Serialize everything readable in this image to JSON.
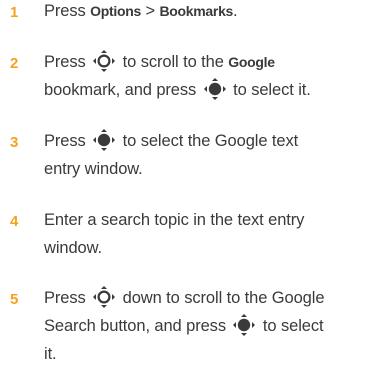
{
  "colors": {
    "accent": "#f4a21f",
    "text": "#3a3a3a"
  },
  "icons": {
    "nav_scroll": "nav-scroll-key-icon",
    "nav_select": "nav-select-key-icon"
  },
  "steps": [
    {
      "num": "1",
      "press": "Press ",
      "options": "Options",
      "gt": " > ",
      "bookmarks": "Bookmarks",
      "end": "."
    },
    {
      "num": "2",
      "press": "Press ",
      "mid": " to scroll to the ",
      "google": "Google",
      "line2a": "bookmark, and press ",
      "line2b": " to select it."
    },
    {
      "num": "3",
      "press": "Press ",
      "mid": " to select the Google text",
      "line2": "entry window."
    },
    {
      "num": "4",
      "line1": "Enter a search topic in the text entry",
      "line2": "window."
    },
    {
      "num": "5",
      "press": "Press ",
      "mid": " down to scroll to the Google",
      "line2a": "Search button, and press ",
      "line2b": " to select",
      "line3": "it."
    }
  ]
}
